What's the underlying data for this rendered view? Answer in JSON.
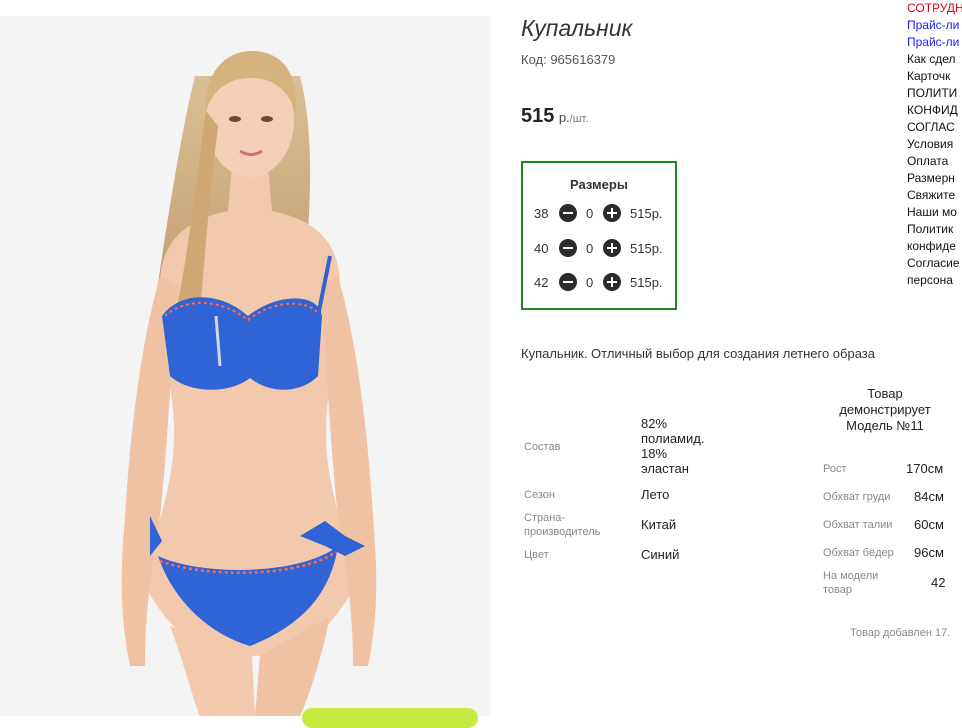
{
  "product": {
    "title": "Купальник",
    "code": "Код: 965616379",
    "price": "515",
    "currency": "р.",
    "unit": "/шт.",
    "description": "Купальник. Отличный выбор для создания летнего образа",
    "added": "Товар добавлен 17."
  },
  "sizes": {
    "title": "Размеры",
    "rows": [
      {
        "size": "38",
        "qty": "0",
        "price": "515р."
      },
      {
        "size": "40",
        "qty": "0",
        "price": "515р."
      },
      {
        "size": "42",
        "qty": "0",
        "price": "515р."
      }
    ]
  },
  "props": [
    {
      "label": "Состав",
      "value": [
        "82%",
        "полиамид.",
        "18%",
        "эластан"
      ]
    },
    {
      "label": "Сезон",
      "value": [
        "Лето"
      ]
    },
    {
      "label": [
        "Страна-",
        "производитель"
      ],
      "value": [
        "Китай"
      ]
    },
    {
      "label": "Цвет",
      "value": [
        "Синий"
      ]
    }
  ],
  "model": {
    "head": [
      "Товар",
      "демонстрирует",
      "Модель №11"
    ],
    "rows": [
      {
        "label": "Рост",
        "value": "170см"
      },
      {
        "label": "Обхват груди",
        "value": "84см"
      },
      {
        "label": "Обхват талии",
        "value": "60см"
      },
      {
        "label": "Обхват бёдер",
        "value": "96см"
      },
      {
        "label": [
          "На модели",
          "товар"
        ],
        "value": "42"
      }
    ]
  },
  "sidebar": {
    "links": [
      "СОТРУДН",
      "Прайс-ли",
      "Прайс-ли",
      "Как сдел",
      "Карточк",
      "ПОЛИТИ",
      "КОНФИД",
      "СОГЛАС",
      "Условия",
      "Оплата",
      "Размерн",
      "Свяжите",
      "Наши мо",
      "Политик",
      "конфиде",
      "Согласие",
      "персона"
    ]
  },
  "colors": {
    "accent_border": "#1a8a1a",
    "swimsuit": "#2f63d6",
    "trim": "#ff6a4a",
    "link_red": "#e0001a",
    "link_blue": "#1a1aff",
    "cta": "#c7ea3e"
  }
}
